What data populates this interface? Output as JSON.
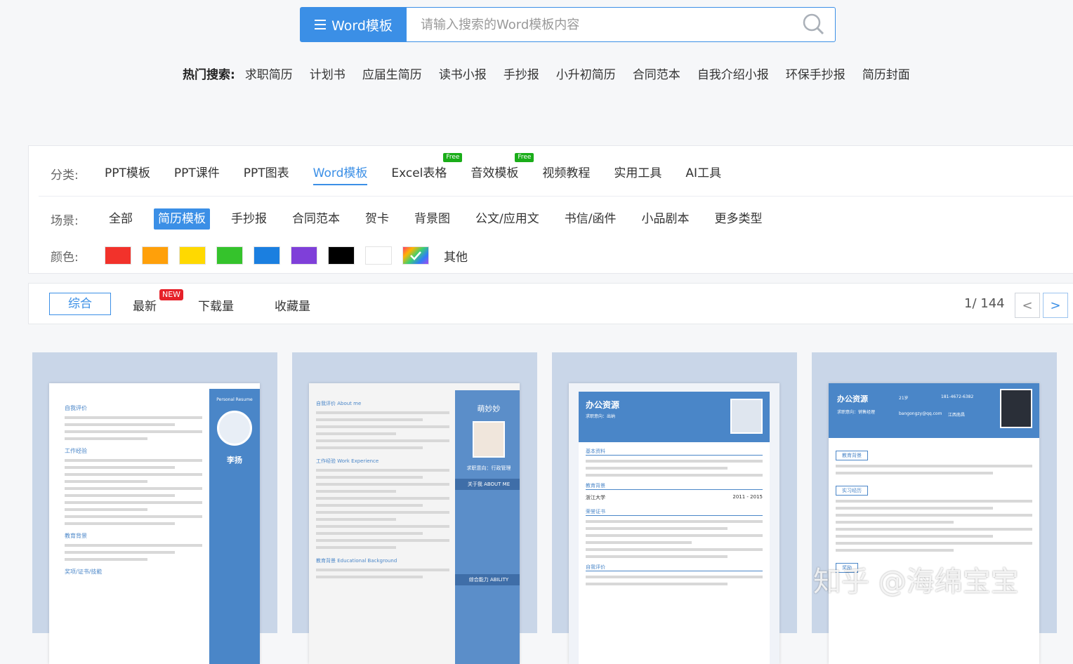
{
  "search": {
    "category_label": "Word模板",
    "placeholder": "请输入搜索的Word模板内容"
  },
  "hot_search": {
    "title": "热门搜索:",
    "items": [
      "求职简历",
      "计划书",
      "应届生简历",
      "读书小报",
      "手抄报",
      "小升初简历",
      "合同范本",
      "自我介绍小报",
      "环保手抄报",
      "简历封面"
    ]
  },
  "categories": {
    "label": "分类:",
    "items": [
      {
        "label": "PPT模板"
      },
      {
        "label": "PPT课件"
      },
      {
        "label": "PPT图表"
      },
      {
        "label": "Word模板"
      },
      {
        "label": "Excel表格",
        "badge": "Free"
      },
      {
        "label": "音效模板",
        "badge": "Free"
      },
      {
        "label": "视频教程"
      },
      {
        "label": "实用工具"
      },
      {
        "label": "AI工具"
      }
    ],
    "active": "Word模板"
  },
  "scenes": {
    "label": "场景:",
    "items": [
      "全部",
      "简历模板",
      "手抄报",
      "合同范本",
      "贺卡",
      "背景图",
      "公文/应用文",
      "书信/函件",
      "小品剧本",
      "更多类型"
    ],
    "active": "简历模板"
  },
  "colors": {
    "label": "颜色:",
    "swatches": [
      "#f2322b",
      "#ffa00a",
      "#ffd900",
      "#35c32c",
      "#1b7fe0",
      "#7f3fd9",
      "#000000",
      "#ffffff",
      "gradient"
    ],
    "other_label": "其他"
  },
  "sort": {
    "items": [
      "综合",
      "最新",
      "下载量",
      "收藏量"
    ],
    "active": "综合",
    "new_badge": "NEW"
  },
  "pagination": {
    "text": "1/ 144",
    "prev": "<",
    "next": ">"
  },
  "cards": [
    {
      "name": "李扬",
      "header": "Personal Resume",
      "sections": [
        "自我评价",
        "工作经验",
        "教育背景",
        "奖项/证书/技能"
      ]
    },
    {
      "name": "萌妙妙",
      "header": "关于我 ABOUT ME",
      "sections": [
        "自我评价 About me",
        "工作经验 Work Experience",
        "教育背景 Educational Background"
      ],
      "side": "求职意向：行政管理",
      "ability": "综合能力 ABILITY"
    },
    {
      "name": "办公资源",
      "header": "求职意向：出纳",
      "sections": [
        "基本资料",
        "教育背景",
        "荣誉证书",
        "自我评价"
      ],
      "school": "浙江大学",
      "years": "2011 - 2015"
    },
    {
      "name": "办公资源",
      "header": "求职意向：销售经理",
      "sections": [
        "教育背景",
        "实习经历",
        "奖励"
      ],
      "age": "21岁",
      "phone": "181-4672-6382",
      "email": "bangongzy@qq.com",
      "place": "江西南昌"
    }
  ],
  "watermark": "知乎 @海绵宝宝"
}
